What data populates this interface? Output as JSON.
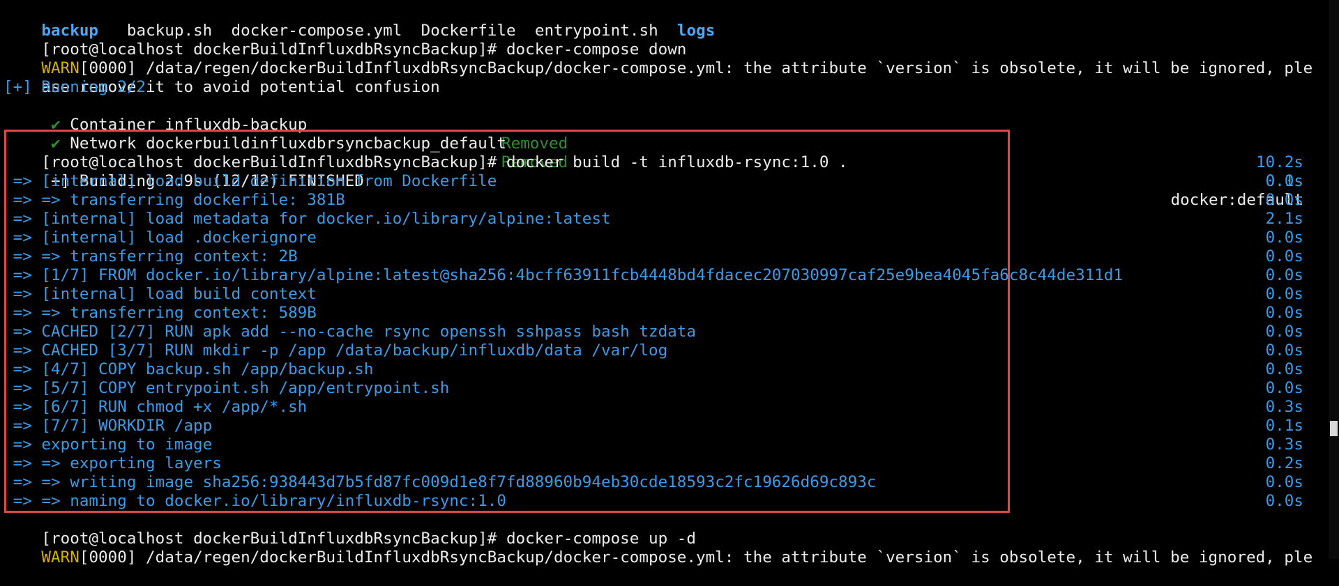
{
  "colors": {
    "background": "#000000",
    "text": "#ececec",
    "blue": "#3b9be6",
    "warn": "#d8b000",
    "green": "#2f8f2f",
    "highlight": "#e04848"
  },
  "ls": [
    "backup",
    "backup.sh",
    "docker-compose.yml",
    "Dockerfile",
    "entrypoint.sh",
    "logs"
  ],
  "prompt": "[root@localhost dockerBuildInfluxdbRsyncBackup]# ",
  "cmd_down": "docker-compose down",
  "warn_tag": "WARN",
  "warn_msg1": "[0000] /data/regen/dockerBuildInfluxdbRsyncBackup/docker-compose.yml: the attribute `version` is obsolete, it will be ignored, ple",
  "warn_msg1_cont": "ase remove it to avoid potential confusion",
  "running": "[+] Running 2/2",
  "checkmark": "✔",
  "removed": [
    {
      "label": "Container influxdb-backup",
      "status": "Removed",
      "time": "10.2s"
    },
    {
      "label": "Network dockerbuildinfluxdbrsyncbackup_default",
      "status": "Removed",
      "time": "0.1s"
    }
  ],
  "cmd_build": "docker build -t influxdb-rsync:1.0 .",
  "building": "[+] Building 2.9s (12/12) FINISHED",
  "builder": "docker:default",
  "steps": [
    {
      "text": " => [internal] load build definition from Dockerfile",
      "time": "0.0s"
    },
    {
      "text": " => => transferring dockerfile: 381B",
      "time": "0.0s"
    },
    {
      "text": " => [internal] load metadata for docker.io/library/alpine:latest",
      "time": "2.1s"
    },
    {
      "text": " => [internal] load .dockerignore",
      "time": "0.0s"
    },
    {
      "text": " => => transferring context: 2B",
      "time": "0.0s"
    },
    {
      "text": " => [1/7] FROM docker.io/library/alpine:latest@sha256:4bcff63911fcb4448bd4fdacec207030997caf25e9bea4045fa6c8c44de311d1",
      "time": "0.0s"
    },
    {
      "text": " => [internal] load build context",
      "time": "0.0s"
    },
    {
      "text": " => => transferring context: 589B",
      "time": "0.0s"
    },
    {
      "text": " => CACHED [2/7] RUN apk add --no-cache rsync openssh sshpass bash tzdata",
      "time": "0.0s"
    },
    {
      "text": " => CACHED [3/7] RUN mkdir -p /app /data/backup/influxdb/data /var/log",
      "time": "0.0s"
    },
    {
      "text": " => [4/7] COPY backup.sh /app/backup.sh",
      "time": "0.0s"
    },
    {
      "text": " => [5/7] COPY entrypoint.sh /app/entrypoint.sh",
      "time": "0.0s"
    },
    {
      "text": " => [6/7] RUN chmod +x /app/*.sh",
      "time": "0.3s"
    },
    {
      "text": " => [7/7] WORKDIR /app",
      "time": "0.1s"
    },
    {
      "text": " => exporting to image",
      "time": "0.3s"
    },
    {
      "text": " => => exporting layers",
      "time": "0.2s"
    },
    {
      "text": " => => writing image sha256:938443d7b5fd87fc009d1e8f7fd88960b94eb30cde18593c2fc19626d69c893c",
      "time": "0.0s"
    },
    {
      "text": " => => naming to docker.io/library/influxdb-rsync:1.0",
      "time": "0.0s"
    }
  ],
  "cmd_up": "docker-compose up -d",
  "warn_msg2": "[0000] /data/regen/dockerBuildInfluxdbRsyncBackup/docker-compose.yml: the attribute `version` is obsolete, it will be ignored, ple"
}
